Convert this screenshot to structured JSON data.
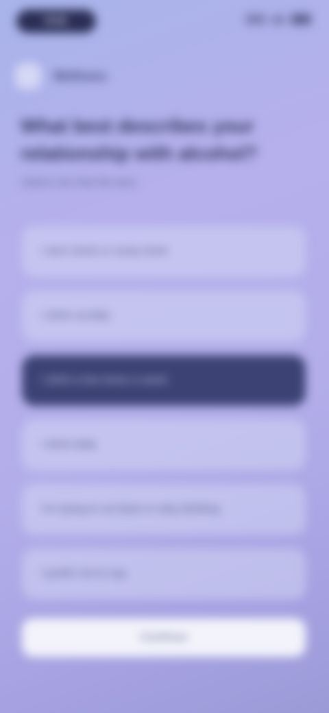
{
  "status_bar": {
    "time": "9:41"
  },
  "header": {
    "app_name": "Wellness"
  },
  "question": {
    "title": "What best describes your relationship with alcohol?",
    "subtitle": "Select one that fits best"
  },
  "options": [
    {
      "label": "I don't drink or rarely drink",
      "selected": false
    },
    {
      "label": "I drink socially",
      "selected": false
    },
    {
      "label": "I drink a few times a week",
      "selected": true
    },
    {
      "label": "I drink daily",
      "selected": false
    },
    {
      "label": "I'm trying to cut back or stop drinking",
      "selected": false
    },
    {
      "label": "I prefer not to say",
      "selected": false
    }
  ],
  "actions": {
    "continue_label": "Continue"
  }
}
